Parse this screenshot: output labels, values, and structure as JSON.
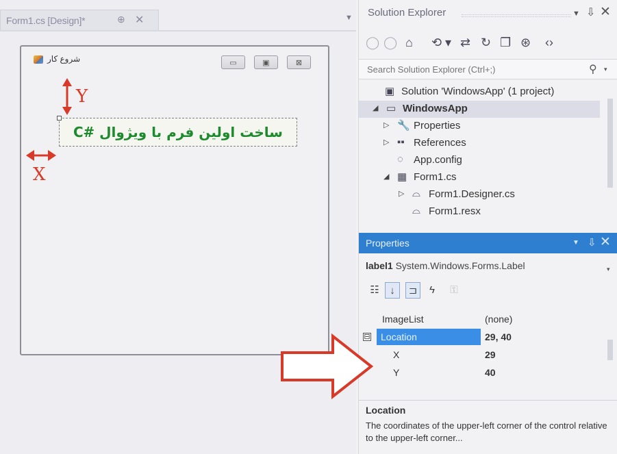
{
  "designer": {
    "tab_label": "Form1.cs [Design]*",
    "tab_pin_glyph": "⊕",
    "tab_close_glyph": "✕",
    "dropdown_glyph": "▼",
    "form": {
      "title": "شروع کار",
      "min_glyph": "▭",
      "max_glyph": "▣",
      "close_glyph": "⊠",
      "label_text": "ساخت اولین فرم با ویژوال #C"
    },
    "annotations": {
      "y_label": "Y",
      "x_label": "X",
      "color": "#d83a2a"
    }
  },
  "solution_explorer": {
    "title": "Solution Explorer",
    "dropdown_glyph": "▼",
    "pin_glyph": "⇩",
    "close_glyph": "✕",
    "toolbar_icons": [
      "back-icon",
      "forward-icon",
      "home-icon",
      "sync-icon",
      "dropdown-icon",
      "refresh-icon",
      "collapse-icon",
      "show-all-icon",
      "properties-icon",
      "code-icon"
    ],
    "toolbar_glyphs": [
      "◯",
      "◯",
      "⌂",
      "⟲",
      "▾",
      "⇄",
      "↻",
      "❐",
      "⊛",
      "‹›"
    ],
    "search_placeholder": "Search Solution Explorer (Ctrl+;)",
    "search_glyph": "⚲",
    "search_dd_glyph": "▾",
    "tree": [
      {
        "label": "Solution 'WindowsApp' (1 project)",
        "icon": "solution-icon",
        "glyph": "▣",
        "level": 0,
        "expander": ""
      },
      {
        "label": "WindowsApp",
        "icon": "csharp-project-icon",
        "glyph": "▭",
        "level": 1,
        "expander": "◢"
      },
      {
        "label": "Properties",
        "icon": "wrench-icon",
        "glyph": "🔧",
        "level": 2,
        "expander": "▷"
      },
      {
        "label": "References",
        "icon": "references-icon",
        "glyph": "▪▪",
        "level": 2,
        "expander": "▷"
      },
      {
        "label": "App.config",
        "icon": "config-file-icon",
        "glyph": "◌",
        "level": 2,
        "expander": ""
      },
      {
        "label": "Form1.cs",
        "icon": "form-file-icon",
        "glyph": "▦",
        "level": 2,
        "expander": "◢"
      },
      {
        "label": "Form1.Designer.cs",
        "icon": "cs-file-icon",
        "glyph": "⌓",
        "level": 3,
        "expander": "▷"
      },
      {
        "label": "Form1.resx",
        "icon": "resx-file-icon",
        "glyph": "⌓",
        "level": 3,
        "expander": ""
      }
    ]
  },
  "properties": {
    "title": "Properties",
    "dropdown_glyph": "▼",
    "pin_glyph": "⇩",
    "close_glyph": "✕",
    "object_name": "label1",
    "object_type": "System.Windows.Forms.Label",
    "object_dd_glyph": "▾",
    "toolbar_glyphs": [
      "☷",
      "↓",
      "⊐",
      "ϟ",
      "⚿"
    ],
    "rows": [
      {
        "name": "ImageList",
        "value": "(none)"
      },
      {
        "name": "Location",
        "value": "29, 40",
        "expander": "⊟"
      },
      {
        "name": "X",
        "value": "29"
      },
      {
        "name": "Y",
        "value": "40"
      }
    ],
    "description_title": "Location",
    "description_text": "The coordinates of the upper-left corner of the control relative to the upper-left corner..."
  }
}
